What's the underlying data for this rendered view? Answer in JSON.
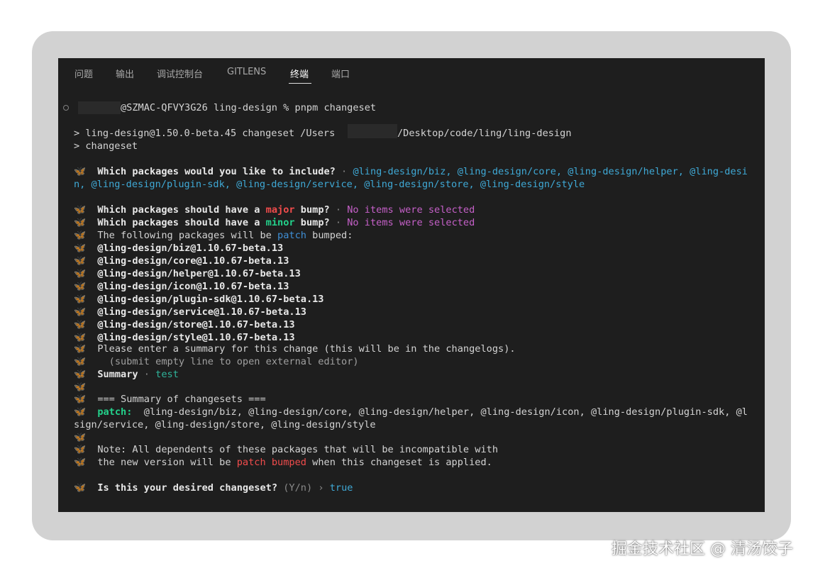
{
  "tabs": [
    {
      "label": "问题"
    },
    {
      "label": "输出"
    },
    {
      "label": "调试控制台"
    },
    {
      "label": "GITLENS"
    },
    {
      "label": "终端",
      "active": true
    },
    {
      "label": "端口"
    }
  ],
  "terminal": {
    "prompt": "@SZMAC-QFVY3G26 ling-design % pnpm changeset",
    "cmd_line1_a": "> ling-design@1.50.0-beta.45 changeset /Users",
    "cmd_line1_b": "/Desktop/code/ling/ling-design",
    "cmd_line2": "> changeset",
    "butterfly": "🦋",
    "q_include": "Which packages would you like to include?",
    "sep": " · ",
    "include_list_1": "@ling-design/biz, @ling-design/core, @ling-design/helper, @ling-desi",
    "include_list_2": "n, @ling-design/plugin-sdk, @ling-design/service, @ling-design/store, @ling-design/style",
    "q_major_a": "Which packages should have a ",
    "q_major_word": "major",
    "q_bump": " bump?",
    "no_items": "No items were selected",
    "q_minor_word": "minor",
    "following_a": "The following packages will be ",
    "following_patch": "patch",
    "following_b": " bumped:",
    "packages": [
      "@ling-design/biz@1.10.67-beta.13",
      "@ling-design/core@1.10.67-beta.13",
      "@ling-design/helper@1.10.67-beta.13",
      "@ling-design/icon@1.10.67-beta.13",
      "@ling-design/plugin-sdk@1.10.67-beta.13",
      "@ling-design/service@1.10.67-beta.13",
      "@ling-design/store@1.10.67-beta.13",
      "@ling-design/style@1.10.67-beta.13"
    ],
    "summary_prompt": "Please enter a summary for this change (this will be in the changelogs).",
    "summary_hint": "  (submit empty line to open external editor)",
    "summary_label": "Summary",
    "summary_value": "test",
    "summary_header": "=== Summary of changesets ===",
    "patch_label": "patch:",
    "patch_list_1": "  @ling-design/biz, @ling-design/core, @ling-design/helper, @ling-design/icon, @ling-design/plugin-sdk, @l",
    "patch_list_2": "sign/service, @ling-design/store, @ling-design/style",
    "note_1": "Note: All dependents of these packages that will be incompatible with",
    "note_2a": "the new version will be ",
    "note_2_red": "patch bumped",
    "note_2b": " when this changeset is applied.",
    "confirm_q": "Is this your desired changeset?",
    "confirm_opts": " (Y/n)",
    "confirm_arrow": " › ",
    "confirm_value": "true"
  },
  "watermark": "掘金技术社区 @ 清汤饺子"
}
